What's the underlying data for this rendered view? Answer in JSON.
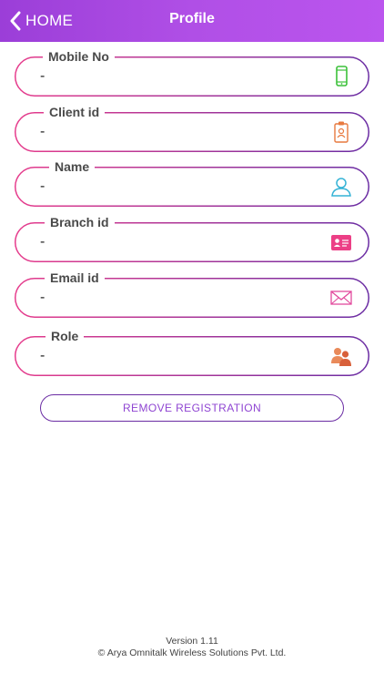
{
  "header": {
    "back_label": "HOME",
    "title": "Profile"
  },
  "fields": [
    {
      "label": "Mobile No",
      "value": "-",
      "icon": "mobile-phone-icon"
    },
    {
      "label": "Client id",
      "value": "-",
      "icon": "id-badge-icon"
    },
    {
      "label": "Name",
      "value": "-",
      "icon": "user-icon"
    },
    {
      "label": "Branch id",
      "value": "-",
      "icon": "id-card-icon"
    },
    {
      "label": "Email id",
      "value": "-",
      "icon": "envelope-icon"
    },
    {
      "label": "Role",
      "value": "-",
      "icon": "users-group-icon"
    }
  ],
  "remove_button": {
    "label": "REMOVE REGISTRATION"
  },
  "footer": {
    "version": "Version 1.11",
    "copyright": "© Arya Omnitalk Wireless Solutions Pvt. Ltd."
  },
  "colors": {
    "header_start": "#9b3ed8",
    "header_end": "#bb55ee",
    "border_pink": "#e63c8c",
    "border_purple": "#6a2ca3",
    "button_text": "#8f45d2"
  }
}
